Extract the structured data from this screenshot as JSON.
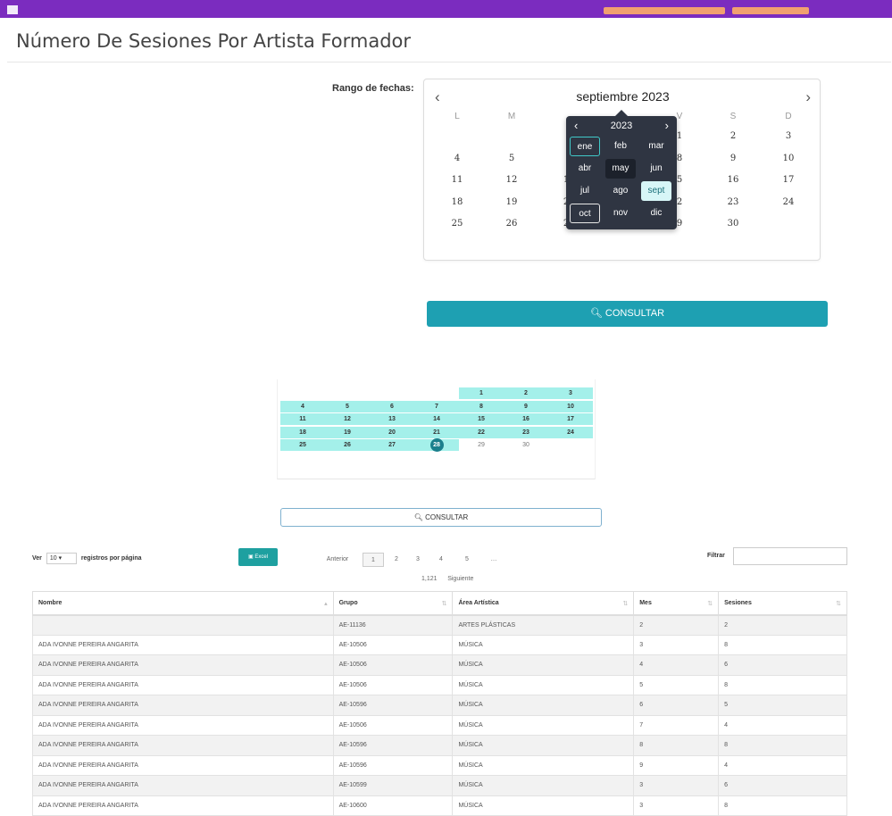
{
  "page": {
    "title": "Número De Sesiones Por Artista Formador"
  },
  "filter_form": {
    "range_label": "Rango de fechas:",
    "calendar": {
      "month_title": "septiembre 2023",
      "prev": "‹",
      "next": "›",
      "weekdays": [
        "L",
        "M",
        "",
        "",
        "V",
        "S",
        "D"
      ],
      "weeks": [
        [
          "",
          "",
          "",
          "",
          "1",
          "2",
          "3"
        ],
        [
          "4",
          "5",
          "",
          "",
          "8",
          "9",
          "10"
        ],
        [
          "11",
          "12",
          "1",
          "",
          "5",
          "16",
          "17"
        ],
        [
          "18",
          "19",
          "2",
          "",
          "2",
          "23",
          "24"
        ],
        [
          "25",
          "26",
          "2",
          "",
          "9",
          "30",
          ""
        ]
      ]
    },
    "month_picker": {
      "year": "2023",
      "prev": "‹",
      "next": "›",
      "months": [
        "ene",
        "feb",
        "mar",
        "abr",
        "may",
        "jun",
        "jul",
        "ago",
        "sept",
        "oct",
        "nov",
        "dic"
      ]
    },
    "consult_button": "CONSULTAR",
    "consult_icon": "search-icon"
  },
  "second_calendar": {
    "weeks": [
      [
        "",
        "",
        "",
        "",
        "1",
        "2",
        "3"
      ],
      [
        "4",
        "5",
        "6",
        "7",
        "8",
        "9",
        "10"
      ],
      [
        "11",
        "12",
        "13",
        "14",
        "15",
        "16",
        "17"
      ],
      [
        "18",
        "19",
        "20",
        "21",
        "22",
        "23",
        "24"
      ],
      [
        "25",
        "26",
        "27",
        "28",
        "29",
        "30",
        ""
      ]
    ],
    "selected_day": "28",
    "consult_button": "CONSULTAR"
  },
  "table_controls": {
    "show_prefix": "Ver",
    "page_size": "10",
    "show_suffix": "registros por página",
    "excel_label": "Excel",
    "filter_label": "Filtrar",
    "pagination": {
      "previous": "Anterior",
      "pages": [
        "1",
        "2",
        "3",
        "4",
        "5",
        "…"
      ],
      "last_page": "1,121",
      "next": "Siguiente"
    }
  },
  "table": {
    "headers": [
      "Nombre",
      "Grupo",
      "Área Artística",
      "Mes",
      "Sesiones"
    ],
    "rows": [
      [
        "",
        "AE-11136",
        "ARTES PLÁSTICAS",
        "2",
        "2"
      ],
      [
        "ADA IVONNE PEREIRA ANGARITA",
        "AE-10506",
        "MÚSICA",
        "3",
        "8"
      ],
      [
        "ADA IVONNE PEREIRA ANGARITA",
        "AE-10506",
        "MÚSICA",
        "4",
        "6"
      ],
      [
        "ADA IVONNE PEREIRA ANGARITA",
        "AE-10506",
        "MÚSICA",
        "5",
        "8"
      ],
      [
        "ADA IVONNE PEREIRA ANGARITA",
        "AE-10596",
        "MÚSICA",
        "6",
        "5"
      ],
      [
        "ADA IVONNE PEREIRA ANGARITA",
        "AE-10506",
        "MÚSICA",
        "7",
        "4"
      ],
      [
        "ADA IVONNE PEREIRA ANGARITA",
        "AE-10596",
        "MÚSICA",
        "8",
        "8"
      ],
      [
        "ADA IVONNE PEREIRA ANGARITA",
        "AE-10596",
        "MÚSICA",
        "9",
        "4"
      ],
      [
        "ADA IVONNE PEREIRA ANGARITA",
        "AE-10599",
        "MÚSICA",
        "3",
        "6"
      ],
      [
        "ADA IVONNE PEREIRA ANGARITA",
        "AE-10600",
        "MÚSICA",
        "3",
        "8"
      ]
    ]
  },
  "colors": {
    "topbar": "#7b2cbf",
    "accent": "#1ea0b2",
    "highlight": "#a4f0ea"
  }
}
